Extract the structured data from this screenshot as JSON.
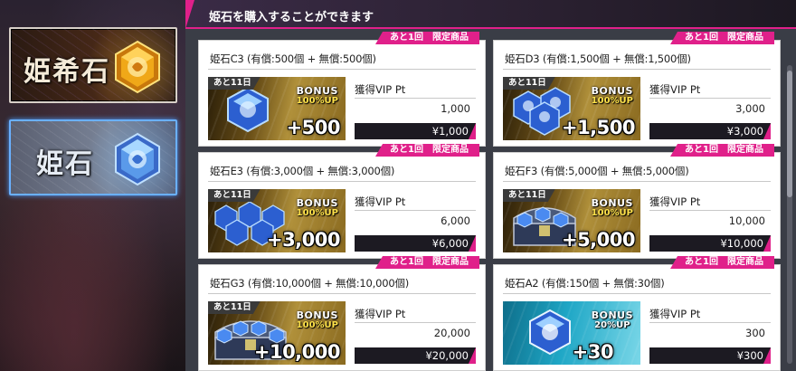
{
  "sidebar": {
    "tabs": [
      {
        "label": "姫希石",
        "icon": "gold-gem-icon"
      },
      {
        "label": "姫石",
        "icon": "blue-gem-icon"
      }
    ]
  },
  "header": {
    "title": "姫石を購入することができます"
  },
  "products": [
    {
      "title": "姫石C3 (有償:500個 + 無償:500個)",
      "badge": "あと1回　限定商品",
      "days": "あと11日",
      "bonus_word": "BONUS",
      "bonus_pct": "100%UP",
      "plus": "+500",
      "vip_label": "獲得VIP Pt",
      "vip": "1,000",
      "price": "¥1,000",
      "gems": 1
    },
    {
      "title": "姫石D3 (有償:1,500個 + 無償:1,500個)",
      "badge": "あと1回　限定商品",
      "days": "あと11日",
      "bonus_word": "BONUS",
      "bonus_pct": "100%UP",
      "plus": "+1,500",
      "vip_label": "獲得VIP Pt",
      "vip": "3,000",
      "price": "¥3,000",
      "gems": 3
    },
    {
      "title": "姫石E3 (有償:3,000個 + 無償:3,000個)",
      "badge": "あと1回　限定商品",
      "days": "あと11日",
      "bonus_word": "BONUS",
      "bonus_pct": "100%UP",
      "plus": "+3,000",
      "vip_label": "獲得VIP Pt",
      "vip": "6,000",
      "price": "¥6,000",
      "gems": 5
    },
    {
      "title": "姫石F3 (有償:5,000個 + 無償:5,000個)",
      "badge": "あと1回　限定商品",
      "days": "あと11日",
      "bonus_word": "BONUS",
      "bonus_pct": "100%UP",
      "plus": "+5,000",
      "vip_label": "獲得VIP Pt",
      "vip": "10,000",
      "price": "¥10,000",
      "gems": 6
    },
    {
      "title": "姫石G3 (有償:10,000個 + 無償:10,000個)",
      "badge": "あと1回　限定商品",
      "days": "あと11日",
      "bonus_word": "BONUS",
      "bonus_pct": "100%UP",
      "plus": "+10,000",
      "vip_label": "獲得VIP Pt",
      "vip": "20,000",
      "price": "¥20,000",
      "gems": 7
    },
    {
      "title": "姫石A2 (有償:150個 + 無償:30個)",
      "badge": "あと1回　限定商品",
      "days": "",
      "bonus_word": "BONUS",
      "bonus_pct": "20%UP",
      "plus": "+30",
      "vip_label": "獲得VIP Pt",
      "vip": "300",
      "price": "¥300",
      "gems": 1
    }
  ],
  "colors": {
    "accent": "#e0208a",
    "header_bg": "#2a2030",
    "price_btn": "#1c1a22"
  }
}
